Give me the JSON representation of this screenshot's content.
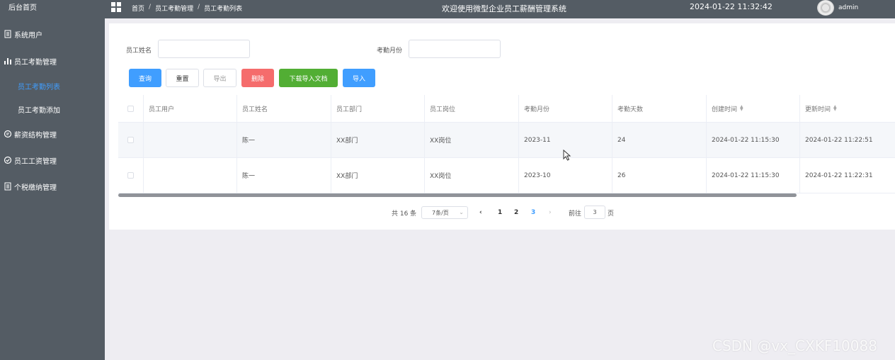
{
  "sidebar": {
    "brand": "后台首页",
    "items": [
      {
        "label": "系统用户"
      },
      {
        "label": "员工考勤管理"
      },
      {
        "label": "员工考勤列表"
      },
      {
        "label": "员工考勤添加"
      },
      {
        "label": "薪资结构管理"
      },
      {
        "label": "员工工资管理"
      },
      {
        "label": "个税缴纳管理"
      }
    ]
  },
  "topbar": {
    "breadcrumb": [
      "首页",
      "员工考勤管理",
      "员工考勤列表"
    ],
    "breadcrumb_sep": "/",
    "welcome": "欢迎使用微型企业员工薪酬管理系统",
    "datetime": "2024-01-22 11:32:42",
    "username": "admin"
  },
  "filters": {
    "name_label": "员工姓名",
    "name_value": "",
    "month_label": "考勤月份",
    "month_value": ""
  },
  "actions": {
    "query": "查询",
    "reset": "重置",
    "export": "导出",
    "delete": "删除",
    "download_template": "下载导入文档",
    "import": "导入"
  },
  "table": {
    "headers": [
      "员工用户",
      "员工姓名",
      "员工部门",
      "员工岗位",
      "考勤月份",
      "考勤天数",
      "创建时间",
      "更新时间"
    ],
    "rows": [
      [
        "",
        "陈一",
        "XX部门",
        "XX岗位",
        "2023-11",
        "24",
        "2024-01-22 11:15:30",
        "2024-01-22 11:22:51"
      ],
      [
        "",
        "陈一",
        "XX部门",
        "XX岗位",
        "2023-10",
        "26",
        "2024-01-22 11:15:30",
        "2024-01-22 11:22:31"
      ]
    ]
  },
  "pagination": {
    "total": "共 16 条",
    "page_size": "7条/页",
    "pages": [
      "1",
      "2",
      "3"
    ],
    "current": "3",
    "goto_label": "前往",
    "goto_value": "3",
    "page_unit": "页"
  },
  "watermark": "CSDN @vx_CXKF10088",
  "colors": {
    "sidebar_bg": "#545c64",
    "accent": "#409eff",
    "danger": "#f56c6c",
    "success": "#52ae34"
  }
}
